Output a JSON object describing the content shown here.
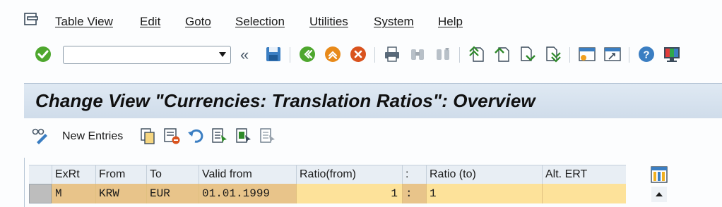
{
  "menu": {
    "items": [
      "Table View",
      "Edit",
      "Goto",
      "Selection",
      "Utilities",
      "System",
      "Help"
    ]
  },
  "toolbar": {
    "command_value": "",
    "icons": [
      "enter-icon",
      "save-icon",
      "back-icon",
      "exit-icon",
      "cancel-icon",
      "print-icon",
      "find-icon",
      "find-next-icon",
      "first-page-icon",
      "previous-page-icon",
      "next-page-icon",
      "last-page-icon",
      "create-session-icon",
      "shortcut-icon",
      "help-icon",
      "customize-layout-icon"
    ]
  },
  "title": "Change View \"Currencies: Translation Ratios\": Overview",
  "app_toolbar": {
    "new_entries_label": "New Entries"
  },
  "table": {
    "columns": [
      "ExRt",
      "From",
      "To",
      "Valid from",
      "Ratio(from)",
      ":",
      "Ratio (to)",
      "Alt. ERT"
    ],
    "rows": [
      {
        "exrt": "M",
        "from": "KRW",
        "to": "EUR",
        "valid_from": "01.01.1999",
        "ratio_from": "1",
        "sep": ":",
        "ratio_to": "1",
        "alt_ert": ""
      }
    ]
  },
  "colors": {
    "title_bar": "#cfdcea",
    "readonly_cell": "#e8c48a",
    "editable_cell": "#fde29a",
    "enter_green": "#4ea72e",
    "exit_orange": "#e88a1a",
    "cancel_red": "#d9531e"
  }
}
